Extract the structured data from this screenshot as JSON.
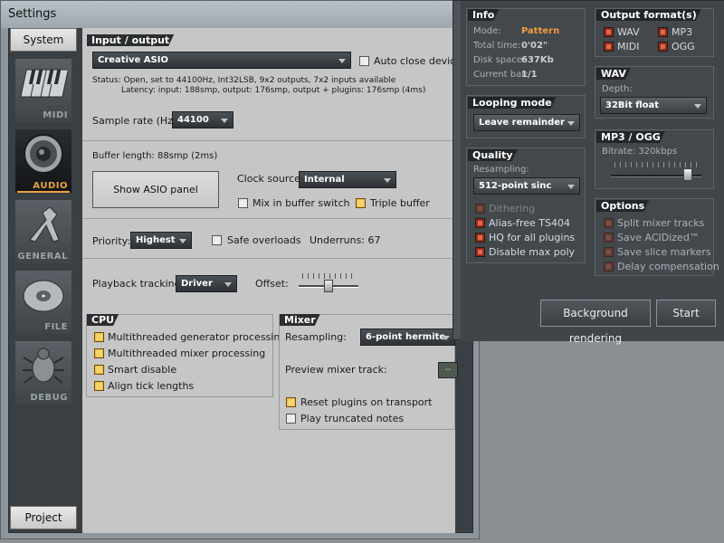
{
  "settings": {
    "title": "Settings",
    "sidebar": {
      "system_tab": "System",
      "items": [
        {
          "label": "MIDI",
          "icon": "piano-keys-icon"
        },
        {
          "label": "AUDIO",
          "icon": "speaker-icon"
        },
        {
          "label": "GENERAL",
          "icon": "wrench-icon"
        },
        {
          "label": "FILE",
          "icon": "disc-icon"
        },
        {
          "label": "DEBUG",
          "icon": "bug-icon"
        }
      ],
      "project_tab": "Project"
    },
    "input_output": {
      "title": "Input / output",
      "device": "Creative ASIO",
      "auto_close_label": "Auto close device",
      "status_line": "Status: Open, set to 44100Hz, Int32LSB, 9x2 outputs, 7x2 inputs available",
      "latency_line": "Latency: input: 188smp, output: 176smp, output + plugins: 176smp (4ms)",
      "sample_rate_label": "Sample rate (Hz):",
      "sample_rate": "44100",
      "buffer_length": "Buffer length: 88smp (2ms)",
      "asio_button": "Show ASIO panel",
      "clock_source_label": "Clock source:",
      "clock_source": "Internal",
      "mix_buffer_switch": "Mix in buffer switch",
      "triple_buffer": "Triple buffer",
      "priority_label": "Priority:",
      "priority": "Highest",
      "safe_overloads": "Safe overloads",
      "underruns": "Underruns: 67",
      "playback_label": "Playback tracking:",
      "playback": "Driver",
      "offset_label": "Offset:"
    },
    "cpu": {
      "title": "CPU",
      "options": [
        "Multithreaded generator processing",
        "Multithreaded mixer processing",
        "Smart disable",
        "Align tick lengths"
      ]
    },
    "mixer": {
      "title": "Mixer",
      "resampling_label": "Resampling:",
      "resampling": "6-point hermite",
      "preview_label": "Preview mixer track:",
      "preview_value": "--",
      "reset_plugins": "Reset plugins on transport",
      "play_truncated": "Play truncated notes"
    }
  },
  "render": {
    "info": {
      "title": "Info",
      "mode_label": "Mode:",
      "mode": "Pattern",
      "total_time_label": "Total time:",
      "total_time": "0'02\"",
      "disk_space_label": "Disk space:",
      "disk_space": "637Kb",
      "current_bar_label": "Current bar:",
      "current_bar": "1/1"
    },
    "output_formats": {
      "title": "Output format(s)",
      "wav": "WAV",
      "mp3": "MP3",
      "midi": "MIDI",
      "ogg": "OGG"
    },
    "wav": {
      "title": "WAV",
      "depth_label": "Depth:",
      "depth": "32Bit float"
    },
    "mp3_ogg": {
      "title": "MP3 / OGG",
      "bitrate": "Bitrate: 320kbps"
    },
    "looping": {
      "title": "Looping mode",
      "value": "Leave remainder"
    },
    "quality": {
      "title": "Quality",
      "resampling_label": "Resampling:",
      "resampling": "512-point sinc",
      "dithering": "Dithering",
      "alias_free": "Alias-free TS404",
      "hq_plugins": "HQ for all plugins",
      "disable_poly": "Disable max poly"
    },
    "options": {
      "title": "Options",
      "split": "Split mixer tracks",
      "acidized": "Save ACIDized™",
      "slice": "Save slice markers",
      "delay": "Delay compensation"
    },
    "background_button": "Background rendering",
    "start_button": "Start"
  }
}
